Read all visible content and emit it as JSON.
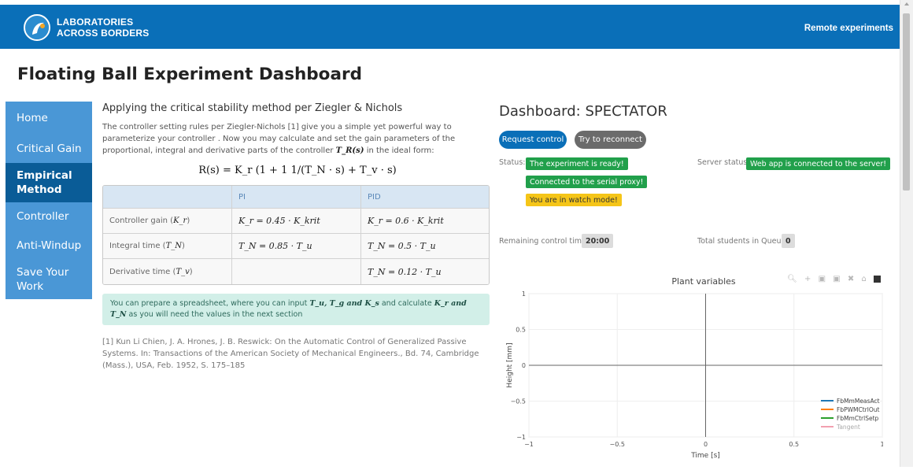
{
  "header": {
    "logo_line1": "LABORATORIES",
    "logo_line2": "ACROSS BORDERS",
    "nav_link": "Remote experiments"
  },
  "page_title": "Floating Ball Experiment Dashboard",
  "sidebar": {
    "items": [
      {
        "label": "Home",
        "active": false
      },
      {
        "label": "Critical Gain",
        "active": false
      },
      {
        "label": "Empirical Method",
        "active": true
      },
      {
        "label": "Controller",
        "active": false
      },
      {
        "label": "Anti-Windup",
        "active": false
      },
      {
        "label": "Save Your Work",
        "active": false
      }
    ]
  },
  "content": {
    "heading": "Applying the critical stability method per Ziegler & Nichols",
    "intro_1": "The controller setting rules per Ziegler-Nichols [1] give you a simple yet powerful way to parameterize your controller . Now you may calculate and set the gain parameters of the proportional, integral and derivative parts of the controller",
    "intro_math": "T_R(s)",
    "intro_2": "in the ideal form:",
    "formula": "R(s) = K_r (1 + 1 1/(T_N · s) + T_v · s)",
    "table": {
      "headers": [
        "",
        "PI",
        "PID"
      ],
      "rows": [
        {
          "label": "Controller gain",
          "label_math": "K_r",
          "pi": "K_r = 0.45 · K_krit",
          "pid": "K_r = 0.6 · K_krit"
        },
        {
          "label": "Integral time",
          "label_math": "T_N",
          "pi": "T_N = 0.85 · T_u",
          "pid": "T_N = 0.5 · T_u"
        },
        {
          "label": "Derivative time",
          "label_math": "T_v",
          "pi": "",
          "pid": "T_N = 0.12 · T_u"
        }
      ]
    },
    "info_pre": "You can prepare a spreadsheet, where you can input",
    "info_vars_in": "T_u, T_g and K_s",
    "info_mid": "and calculate",
    "info_vars_out": "K_r and T_N",
    "info_post": "as you will need the values in the next section",
    "reference": "[1] Kun Li Chien, J. A. Hrones, J. B. Reswick: On the Automatic Control of Generalized Passive Systems. In: Transactions of the American Society of Mechanical Engineers., Bd. 74, Cambridge (Mass.), USA, Feb. 1952, S. 175–185"
  },
  "dashboard": {
    "title": "Dashboard: SPECTATOR",
    "request_control": "Request control",
    "try_reconnect": "Try to reconnect",
    "status_label": "Status:",
    "status_badges": [
      "The experiment is ready!",
      "Connected to the serial proxy!",
      "You are in watch mode!"
    ],
    "server_status_label": "Server status:",
    "server_status": "Web app is connected to the server!",
    "remaining_label": "Remaining control time:",
    "remaining_value": "20:00",
    "queue_label": "Total students in Queue:",
    "queue_value": "0"
  },
  "plot": {
    "title": "Plant variables",
    "modebar": [
      "zoom-icon",
      "pan-icon",
      "zoom-in-icon",
      "zoom-out-icon",
      "autoscale-icon",
      "reset-icon",
      "plotly-logo"
    ],
    "colors": {
      "FbMmMeasAct": "#1f77b4",
      "FbPWMCtrlOut": "#ff7f0e",
      "FbMmCtrlSetp": "#2ca02c",
      "Tangent": "#e377c2"
    }
  },
  "chart_data": {
    "type": "line",
    "title": "Plant variables",
    "xlabel": "Time [s]",
    "ylabel": "Height [mm]",
    "xlim": [
      -1,
      1
    ],
    "ylim": [
      -1,
      1
    ],
    "x_ticks": [
      "−1",
      "−0.5",
      "0",
      "0.5",
      "1"
    ],
    "y_ticks": [
      "1",
      "0.5",
      "0",
      "−0.5",
      "−1"
    ],
    "x_tick_values": [
      -1,
      -0.5,
      0,
      0.5,
      1
    ],
    "y_tick_values": [
      1,
      0.5,
      0,
      -0.5,
      -1
    ],
    "grid": true,
    "legend_position": "bottom-right",
    "series": [
      {
        "name": "FbMmMeasAct",
        "color": "#1f77b4",
        "values": []
      },
      {
        "name": "FbPWMCtrlOut",
        "color": "#ff7f0e",
        "values": []
      },
      {
        "name": "FbMmCtrlSetp",
        "color": "#2ca02c",
        "values": []
      },
      {
        "name": "Tangent",
        "color": "#f2a0b0",
        "values": []
      }
    ]
  }
}
